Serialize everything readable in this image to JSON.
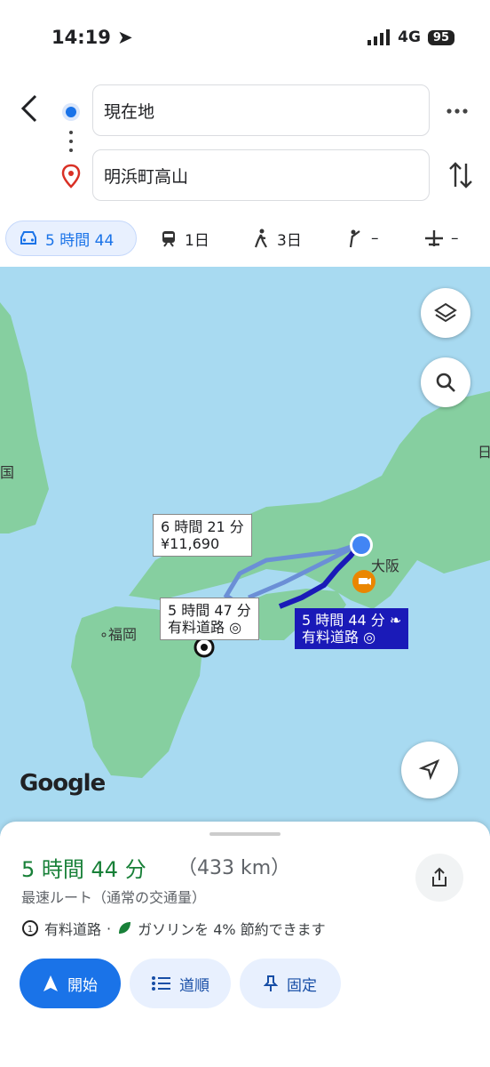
{
  "status": {
    "time": "14:19",
    "network": "4G",
    "battery": "95"
  },
  "route": {
    "origin": "現在地",
    "destination": "明浜町高山"
  },
  "modes": [
    {
      "icon": "car-icon",
      "label": "5 時間 44"
    },
    {
      "icon": "train-icon",
      "label": "1日"
    },
    {
      "icon": "walk-icon",
      "label": "3日"
    },
    {
      "icon": "rideshare-icon",
      "label": "–"
    },
    {
      "icon": "plane-icon",
      "label": "–"
    }
  ],
  "map": {
    "cities": {
      "fukuoka": "福岡",
      "osaka": "大阪",
      "left_edge": "国",
      "right_edge": "日"
    },
    "alt1": {
      "time": "6 時間 21 分",
      "toll": "¥11,690"
    },
    "alt2": {
      "time": "5 時間 47 分",
      "toll": "有料道路"
    },
    "best": {
      "time": "5 時間 44 分",
      "toll": "有料道路"
    },
    "google": "Google"
  },
  "summary": {
    "duration": "5 時間 44 分",
    "distance": "（433 km）",
    "subtitle": "最速ルート（通常の交通量）",
    "toll_label": "有料道路",
    "separator": "·",
    "eco_label": "ガソリンを 4% 節約できます"
  },
  "actions": {
    "start": "開始",
    "steps": "道順",
    "pin": "固定"
  },
  "colors": {
    "accent": "#1a73e8",
    "green": "#188038",
    "route": "#1a1ab8"
  }
}
